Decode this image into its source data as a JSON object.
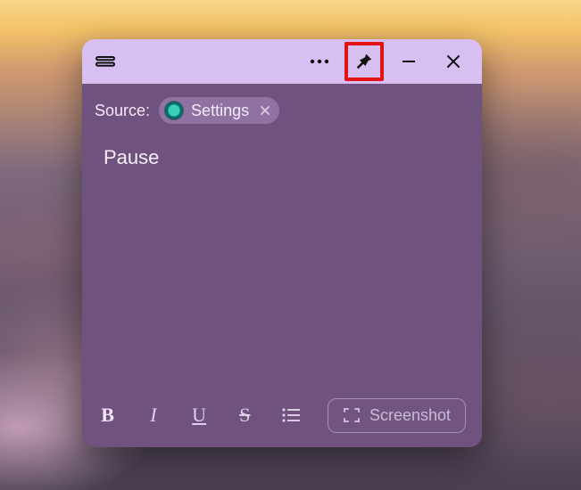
{
  "titlebar": {
    "grip_icon": "grip-lines-icon",
    "more_icon": "more-horizontal-icon",
    "pin_icon": "pin-icon",
    "minimize_icon": "minimize-icon",
    "close_icon": "close-icon"
  },
  "source": {
    "label": "Source:",
    "chip": {
      "app_icon": "settings-app-icon",
      "name": "Settings",
      "remove_icon": "close-icon"
    }
  },
  "content": {
    "text": "Pause"
  },
  "toolbar": {
    "bold": "B",
    "italic": "I",
    "underline": "U",
    "strike": "S",
    "list_icon": "bullet-list-icon",
    "screenshot": {
      "icon": "capture-icon",
      "label": "Screenshot"
    }
  },
  "highlight": {
    "target": "pin-button"
  }
}
